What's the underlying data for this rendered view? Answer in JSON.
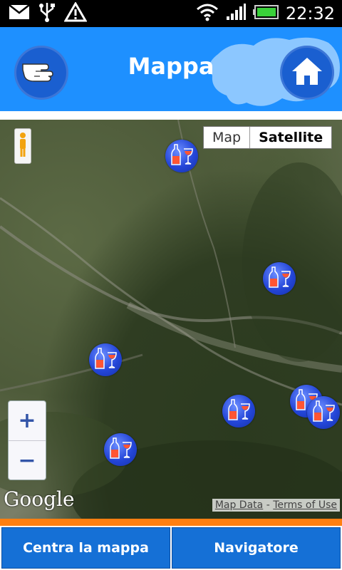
{
  "status_bar": {
    "time": "22:32",
    "icons": [
      "mail-icon",
      "usb-icon",
      "warning-icon",
      "wifi-icon",
      "signal-icon",
      "battery-icon"
    ]
  },
  "header": {
    "title": "Mappa",
    "back_icon": "pointing-hand-icon",
    "home_icon": "home-icon"
  },
  "map": {
    "map_type_options": [
      "Map",
      "Satellite"
    ],
    "selected_map_type": "Satellite",
    "zoom_in_label": "+",
    "zoom_out_label": "−",
    "google_logo": "Google",
    "map_data_link": "Map Data",
    "separator": "-",
    "terms_link": "Terms of Use",
    "marker_icon": "wine-bottle-glass-icon"
  },
  "bottom_bar": {
    "center_button": "Centra la mappa",
    "navigator_button": "Navigatore"
  },
  "colors": {
    "header_bg": "#1e90ff",
    "accent_orange": "#ff7f11",
    "button_blue": "#1570d6"
  }
}
